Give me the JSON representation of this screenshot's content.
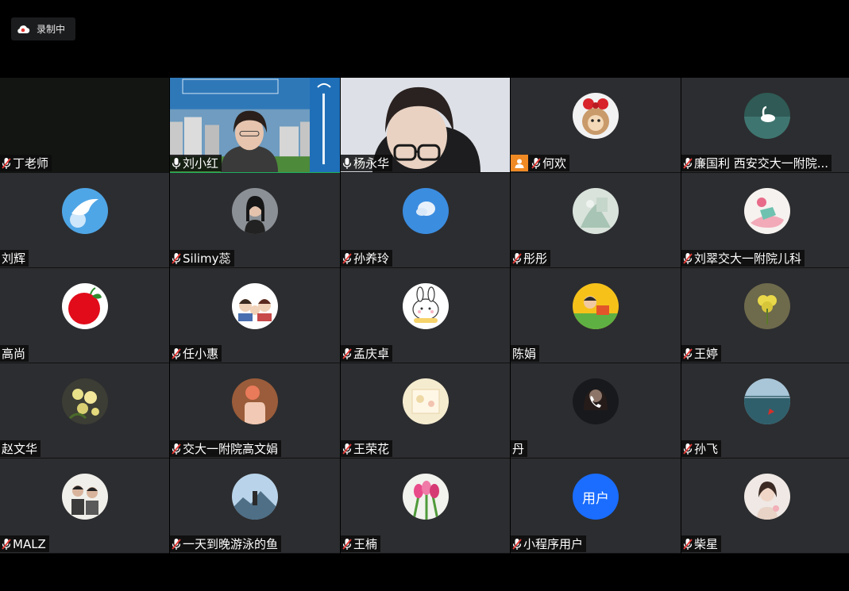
{
  "recording": {
    "label": "录制中"
  },
  "participants": [
    {
      "name": "丁老师",
      "muted": true,
      "type": "dark"
    },
    {
      "name": "刘小红",
      "muted": false,
      "type": "video1"
    },
    {
      "name": "杨永华",
      "muted": false,
      "type": "video2"
    },
    {
      "name": "何欢",
      "muted": true,
      "type": "avatar",
      "host": true,
      "avatar": "doll"
    },
    {
      "name": "廉国利 西安交大一附院...",
      "muted": true,
      "type": "avatar",
      "avatar": "swan"
    },
    {
      "name": "刘辉",
      "muted": false,
      "nomic": true,
      "type": "avatar",
      "avatar": "dove"
    },
    {
      "name": "Silimy蕊",
      "muted": true,
      "type": "avatar",
      "avatar": "woman"
    },
    {
      "name": "孙养玲",
      "muted": true,
      "type": "avatar",
      "avatar": "sky"
    },
    {
      "name": "彤彤",
      "muted": true,
      "type": "avatar",
      "avatar": "painting"
    },
    {
      "name": "刘翠交大一附院儿科",
      "muted": true,
      "type": "avatar",
      "avatar": "pinkgirl"
    },
    {
      "name": "高尚",
      "muted": false,
      "nomic": true,
      "type": "avatar",
      "avatar": "tomato"
    },
    {
      "name": "任小惠",
      "muted": true,
      "type": "avatar",
      "avatar": "family"
    },
    {
      "name": "孟庆卓",
      "muted": true,
      "type": "avatar",
      "avatar": "bunny"
    },
    {
      "name": "陈娟",
      "muted": false,
      "nomic": true,
      "type": "avatar",
      "avatar": "cartoon"
    },
    {
      "name": "王婷",
      "muted": true,
      "type": "avatar",
      "avatar": "clover"
    },
    {
      "name": "赵文华",
      "muted": false,
      "nomic": true,
      "type": "avatar",
      "avatar": "flowers"
    },
    {
      "name": "交大一附院高文娟",
      "muted": true,
      "type": "avatar",
      "avatar": "hand"
    },
    {
      "name": "王荣花",
      "muted": true,
      "type": "avatar",
      "avatar": "cream"
    },
    {
      "name": "丹",
      "muted": false,
      "nomic": true,
      "type": "avatar",
      "avatar": "phone",
      "status": "正在接听系统电话"
    },
    {
      "name": "孙飞",
      "muted": true,
      "type": "avatar",
      "avatar": "sea"
    },
    {
      "name": "MALZ",
      "muted": true,
      "type": "avatar",
      "avatar": "couple"
    },
    {
      "name": "一天到晚游泳的鱼",
      "muted": true,
      "type": "avatar",
      "avatar": "mountain"
    },
    {
      "name": "王楠",
      "muted": true,
      "type": "avatar",
      "avatar": "tulips"
    },
    {
      "name": "小程序用户",
      "muted": true,
      "type": "text",
      "avatar_text": "用户"
    },
    {
      "name": "柴星",
      "muted": true,
      "type": "avatar",
      "avatar": "girl"
    }
  ]
}
